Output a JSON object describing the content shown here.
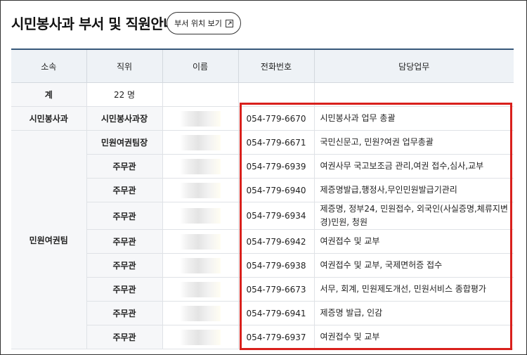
{
  "page": {
    "title": "시민봉사과 부서 및 직원안내",
    "location_button_label": "부서 위치 보기"
  },
  "table": {
    "headers": [
      "소속",
      "직위",
      "이름",
      "전화번호",
      "담당업무"
    ],
    "total_row": {
      "label": "계",
      "count": "22 명"
    },
    "departments": [
      "시민봉사과",
      "민원여권팀"
    ],
    "rows": [
      {
        "rank": "시민봉사과장",
        "phone": "054-779-6670",
        "duty": "시민봉사과 업무 총괄"
      },
      {
        "rank": "민원여권팀장",
        "phone": "054-779-6671",
        "duty": "국민신문고, 민원?여권 업무총괄"
      },
      {
        "rank": "주무관",
        "phone": "054-779-6939",
        "duty": "여권사무 국고보조금 관리,여권 접수,심사,교부"
      },
      {
        "rank": "주무관",
        "phone": "054-779-6940",
        "duty": "제증명발급,행정사,무인민원발급기관리"
      },
      {
        "rank": "주무관",
        "phone": "054-779-6934",
        "duty": "제증명, 정부24, 민원접수, 외국인(사실증명,체류지변경)민원, 청원"
      },
      {
        "rank": "주무관",
        "phone": "054-779-6942",
        "duty": "여권접수 및 교부"
      },
      {
        "rank": "주무관",
        "phone": "054-779-6938",
        "duty": "여권접수 및 교부, 국제면허증 접수"
      },
      {
        "rank": "주무관",
        "phone": "054-779-6673",
        "duty": "서무, 회계, 민원제도개선, 민원서비스 종합평가"
      },
      {
        "rank": "주무관",
        "phone": "054-779-6941",
        "duty": "제증명 발급, 인감"
      },
      {
        "rank": "주무관",
        "phone": "054-779-6937",
        "duty": "여권접수 및 교부"
      }
    ]
  },
  "icons": {
    "location_button_icon": "external-link-icon"
  },
  "colors": {
    "highlight": "#d9201c",
    "header_bg": "#eef2f6",
    "header_top_border": "#37587a"
  }
}
